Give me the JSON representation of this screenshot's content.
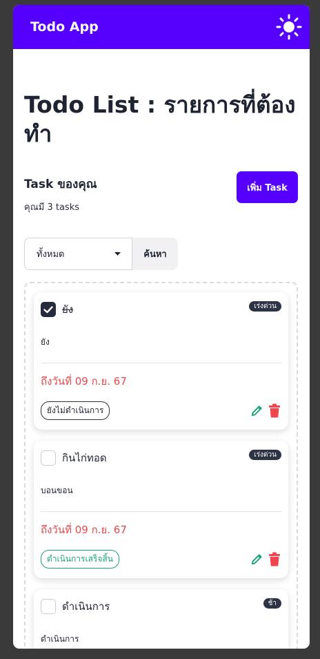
{
  "app": {
    "title": "Todo App"
  },
  "page": {
    "title": "Todo List : รายการที่ต้องทำ"
  },
  "summary": {
    "heading": "Task ของคุณ",
    "count_text": "คุณมี 3 tasks",
    "add_label": "เพิ่ม Task"
  },
  "filter": {
    "selected": "ทั้งหมด",
    "search_label": "ค้นหา"
  },
  "tasks": [
    {
      "title": "ยัง",
      "done": true,
      "badge": "เร่งด่วน",
      "description": "ยัง",
      "due": "ถึงวันที่ 09 ก.ย. 67",
      "status": "ยังไม่ดำเนินการ"
    },
    {
      "title": "กินไก่ทอด",
      "done": false,
      "badge": "เร่งด่วน",
      "description": "บอนขอน",
      "due": "ถึงวันที่ 09 ก.ย. 67",
      "status": "ดำเนินการเสร็จสิ้น"
    },
    {
      "title": "ดำเนินการ",
      "done": false,
      "badge": "ช้า",
      "description": "ดำเนินการ"
    }
  ],
  "colors": {
    "accent": "#5500ff",
    "due": "#e5484d",
    "edit": "#1aa37a",
    "delete": "#f0444f",
    "badge": "#2d3445"
  }
}
